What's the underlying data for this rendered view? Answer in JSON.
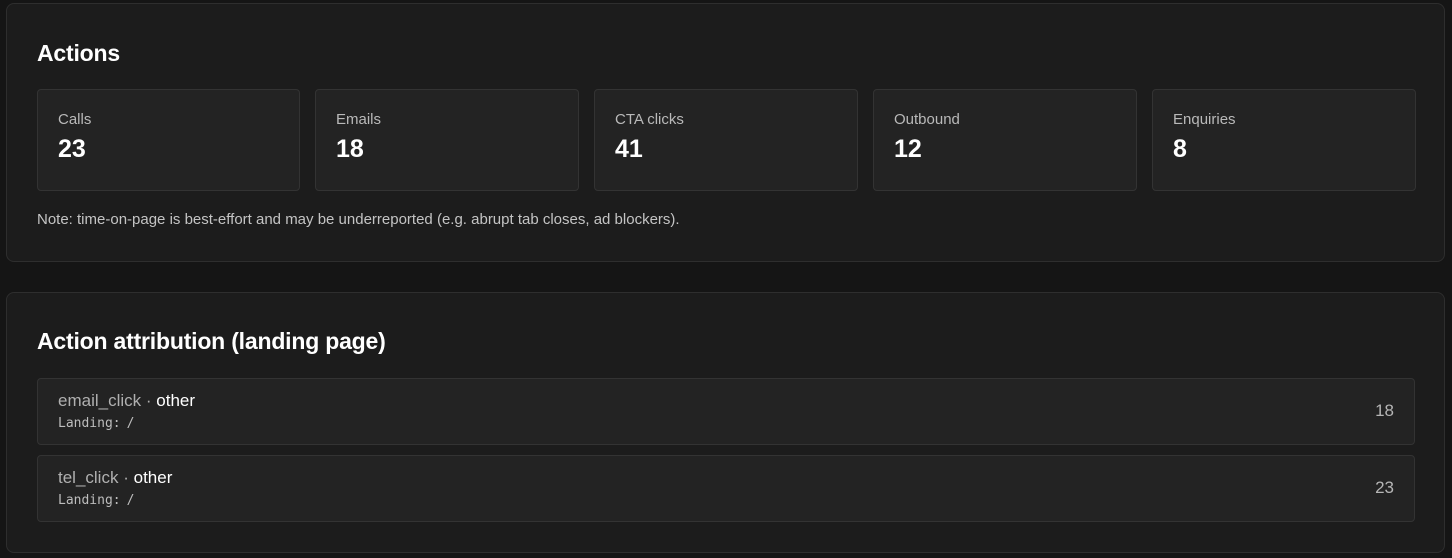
{
  "actions": {
    "title": "Actions",
    "stats": [
      {
        "label": "Calls",
        "value": "23"
      },
      {
        "label": "Emails",
        "value": "18"
      },
      {
        "label": "CTA clicks",
        "value": "41"
      },
      {
        "label": "Outbound",
        "value": "12"
      },
      {
        "label": "Enquiries",
        "value": "8"
      }
    ],
    "note": "Note: time-on-page is best-effort and may be underreported (e.g. abrupt tab closes, ad blockers)."
  },
  "attribution": {
    "title": "Action attribution (landing page)",
    "separator": "·",
    "landing_label": "Landing:",
    "rows": [
      {
        "event": "email_click",
        "source": "other",
        "landing": "/",
        "count": "18"
      },
      {
        "event": "tel_click",
        "source": "other",
        "landing": "/",
        "count": "23"
      }
    ]
  }
}
